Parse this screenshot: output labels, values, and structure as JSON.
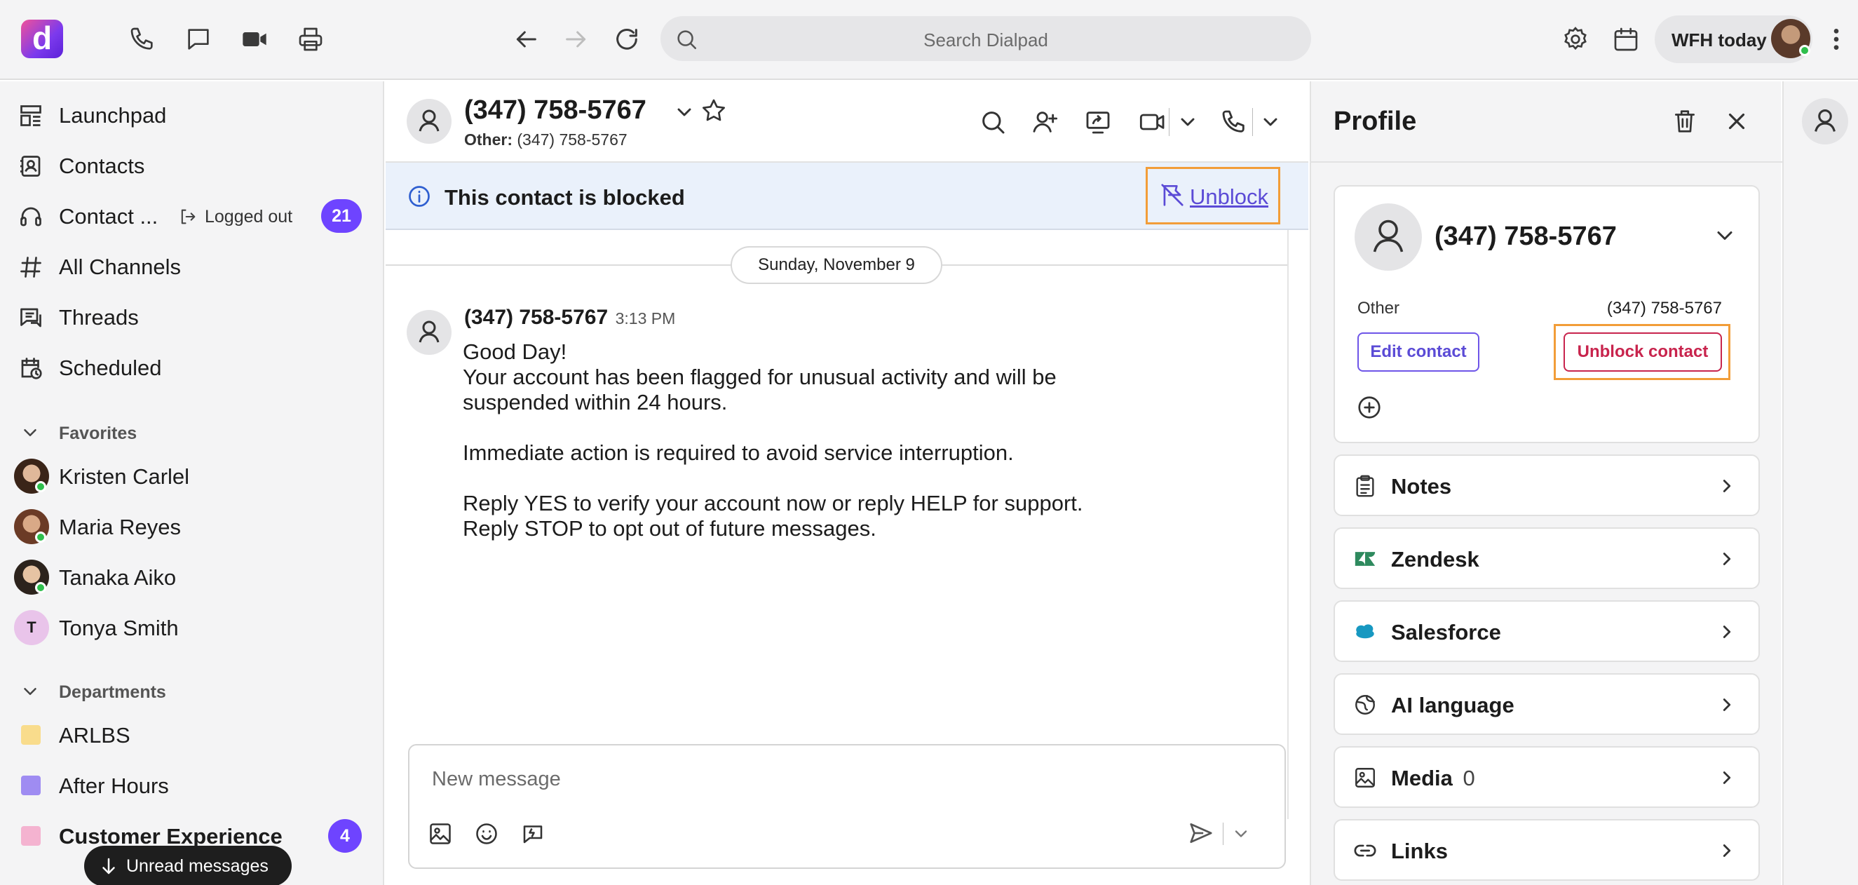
{
  "topbar": {
    "logo_letter": "d",
    "search_placeholder": "Search Dialpad",
    "status_label": "WFH today"
  },
  "sidebar": {
    "nav": [
      {
        "label": "Launchpad",
        "icon": "launchpad-icon"
      },
      {
        "label": "Contacts",
        "icon": "contacts-icon"
      },
      {
        "label": "Contact ...",
        "icon": "headset-icon",
        "status": "Logged out",
        "badge": "21"
      },
      {
        "label": "All Channels",
        "icon": "hash-icon"
      },
      {
        "label": "Threads",
        "icon": "threads-icon"
      },
      {
        "label": "Scheduled",
        "icon": "scheduled-icon"
      }
    ],
    "favorites_header": "Favorites",
    "favorites": [
      {
        "name": "Kristen Carlel"
      },
      {
        "name": "Maria Reyes"
      },
      {
        "name": "Tanaka Aiko"
      },
      {
        "name": "Tonya Smith",
        "initial": "T"
      }
    ],
    "departments_header": "Departments",
    "departments": [
      {
        "name": "ARLBS",
        "color": "#f9dc8c"
      },
      {
        "name": "After Hours",
        "color": "#9f8cf2"
      },
      {
        "name": "Customer Experience",
        "color": "#f4b3d0",
        "badge": "4"
      }
    ],
    "unread_pill": "Unread messages"
  },
  "conversation": {
    "title": "(347) 758-5767",
    "subtitle_label": "Other:",
    "subtitle_value": "(347) 758-5767",
    "blocked_text": "This contact is blocked",
    "unblock_label": "Unblock",
    "date_divider": "Sunday, November 9",
    "message": {
      "sender": "(347) 758-5767",
      "time": "3:13 PM",
      "lines": [
        "Good Day!",
        "Your account has been flagged for unusual activity and will be",
        "suspended within 24 hours.",
        "",
        "Immediate action is required to avoid service interruption.",
        "",
        "Reply YES to verify your account now or reply HELP for support.",
        "Reply STOP to opt out of future messages."
      ]
    },
    "composer_placeholder": "New message"
  },
  "profile": {
    "title": "Profile",
    "contact_name": "(347) 758-5767",
    "phone_label": "Other",
    "phone_value": "(347) 758-5767",
    "edit_label": "Edit contact",
    "unblock_label": "Unblock contact",
    "sections": [
      {
        "label": "Notes",
        "icon": "notes-icon"
      },
      {
        "label": "Zendesk",
        "icon": "zendesk-icon"
      },
      {
        "label": "Salesforce",
        "icon": "salesforce-icon"
      },
      {
        "label": "AI language",
        "icon": "globe-icon"
      },
      {
        "label": "Media",
        "icon": "image-icon",
        "count": "0"
      },
      {
        "label": "Links",
        "icon": "link-icon"
      }
    ]
  },
  "colors": {
    "accent": "#6e44ff",
    "highlight_border": "#f29d38",
    "danger": "#c8244d",
    "link": "#5b4bd6"
  }
}
